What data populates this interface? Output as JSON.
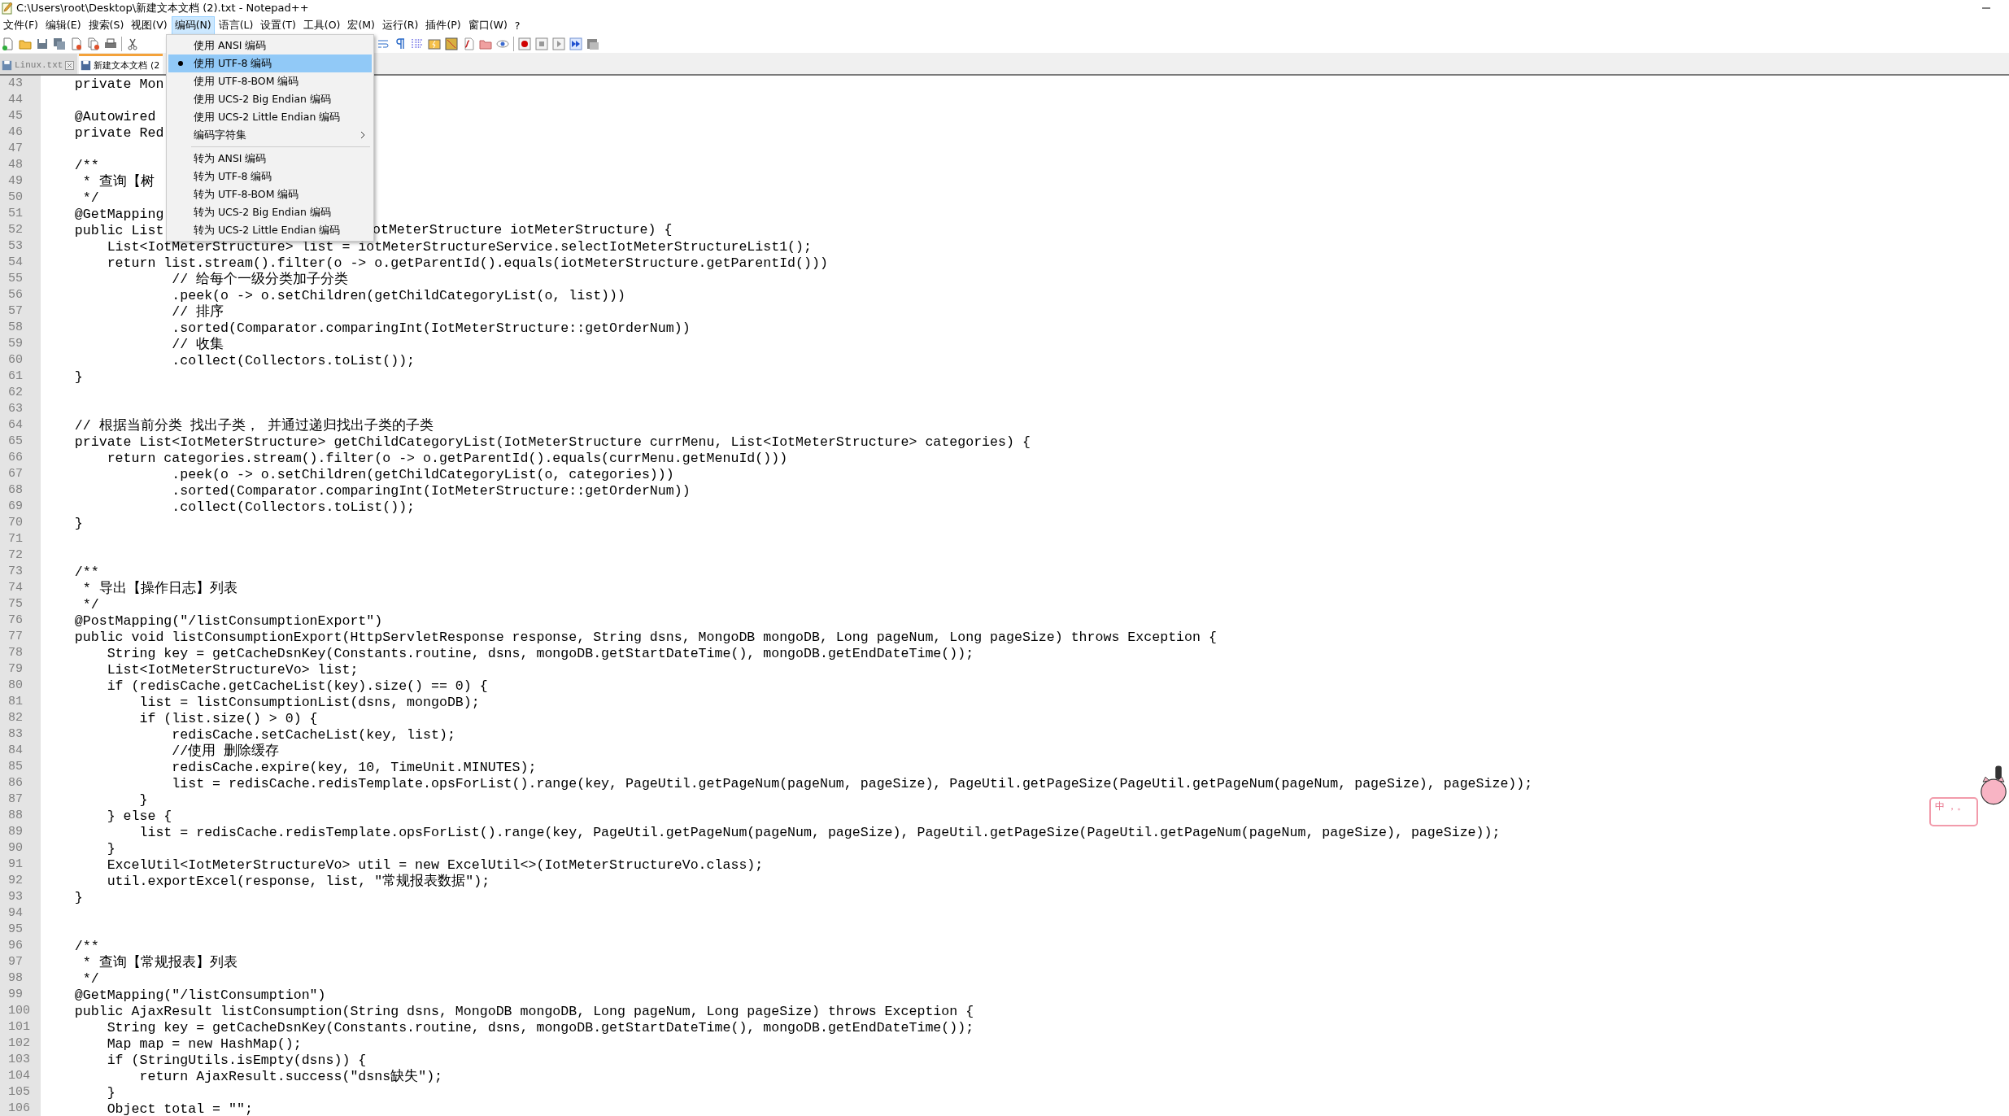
{
  "window": {
    "title": "C:\\Users\\root\\Desktop\\新建文本文档 (2).txt - Notepad++"
  },
  "menu_bar": [
    {
      "label": "文件(F)",
      "selected": false
    },
    {
      "label": "编辑(E)",
      "selected": false
    },
    {
      "label": "搜索(S)",
      "selected": false
    },
    {
      "label": "视图(V)",
      "selected": false
    },
    {
      "label": "编码(N)",
      "selected": true
    },
    {
      "label": "语言(L)",
      "selected": false
    },
    {
      "label": "设置(T)",
      "selected": false
    },
    {
      "label": "工具(O)",
      "selected": false
    },
    {
      "label": "宏(M)",
      "selected": false
    },
    {
      "label": "运行(R)",
      "selected": false
    },
    {
      "label": "插件(P)",
      "selected": false
    },
    {
      "label": "窗口(W)",
      "selected": false
    },
    {
      "label": "?",
      "selected": false
    }
  ],
  "tabs": [
    {
      "label": "Linux.txt",
      "selected": false
    },
    {
      "label": "新建文本文档 (2",
      "selected": true
    }
  ],
  "encoding_menu": [
    {
      "kind": "item",
      "label": "使用 ANSI 编码",
      "checked": false,
      "selected": false
    },
    {
      "kind": "item",
      "label": "使用 UTF-8 编码",
      "checked": true,
      "selected": true
    },
    {
      "kind": "item",
      "label": "使用 UTF-8-BOM 编码",
      "checked": false,
      "selected": false
    },
    {
      "kind": "item",
      "label": "使用 UCS-2 Big Endian 编码",
      "checked": false,
      "selected": false
    },
    {
      "kind": "item",
      "label": "使用 UCS-2 Little Endian 编码",
      "checked": false,
      "selected": false
    },
    {
      "kind": "submenu",
      "label": "编码字符集",
      "checked": false,
      "selected": false
    },
    {
      "kind": "separator"
    },
    {
      "kind": "item",
      "label": "转为 ANSI 编码",
      "checked": false,
      "selected": false
    },
    {
      "kind": "item",
      "label": "转为 UTF-8 编码",
      "checked": false,
      "selected": false
    },
    {
      "kind": "item",
      "label": "转为 UTF-8-BOM 编码",
      "checked": false,
      "selected": false
    },
    {
      "kind": "item",
      "label": "转为 UCS-2 Big Endian 编码",
      "checked": false,
      "selected": false
    },
    {
      "kind": "item",
      "label": "转为 UCS-2 Little Endian 编码",
      "checked": false,
      "selected": false
    }
  ],
  "editor_lines": [
    {
      "number": "43",
      "text": "    private Mon"
    },
    {
      "number": "44"
    },
    {
      "number": "45",
      "text": "    @Autowired"
    },
    {
      "number": "46",
      "text": "    private Red"
    },
    {
      "number": "47"
    },
    {
      "number": "48",
      "text": "    /**"
    },
    {
      "number": "49",
      "text": "     * 查询【树"
    },
    {
      "number": "50",
      "text": "     */"
    },
    {
      "number": "51",
      "text": "    @GetMapping"
    },
    {
      "number": "52",
      "text": "    public List",
      "tail": "otMeterStructure iotMeterStructure) {"
    },
    {
      "number": "53",
      "text": "        List<IotMeterStructure> list = iotMeterStructureService.selectIotMeterStructureList1();"
    },
    {
      "number": "54",
      "text": "        return list.stream().filter(o -> o.getParentId().equals(iotMeterStructure.getParentId()))"
    },
    {
      "number": "55",
      "text": "                // 给每个一级分类加子分类"
    },
    {
      "number": "56",
      "text": "                .peek(o -> o.setChildren(getChildCategoryList(o, list)))"
    },
    {
      "number": "57",
      "text": "                // 排序"
    },
    {
      "number": "58",
      "text": "                .sorted(Comparator.comparingInt(IotMeterStructure::getOrderNum))"
    },
    {
      "number": "59",
      "text": "                // 收集"
    },
    {
      "number": "60",
      "text": "                .collect(Collectors.toList());"
    },
    {
      "number": "61",
      "text": "    }"
    },
    {
      "number": "62"
    },
    {
      "number": "63"
    },
    {
      "number": "64",
      "text": "    // 根据当前分类 找出子类， 并通过递归找出子类的子类"
    },
    {
      "number": "65",
      "text": "    private List<IotMeterStructure> getChildCategoryList(IotMeterStructure currMenu, List<IotMeterStructure> categories) {"
    },
    {
      "number": "66",
      "text": "        return categories.stream().filter(o -> o.getParentId().equals(currMenu.getMenuId()))"
    },
    {
      "number": "67",
      "text": "                .peek(o -> o.setChildren(getChildCategoryList(o, categories)))"
    },
    {
      "number": "68",
      "text": "                .sorted(Comparator.comparingInt(IotMeterStructure::getOrderNum))"
    },
    {
      "number": "69",
      "text": "                .collect(Collectors.toList());"
    },
    {
      "number": "70",
      "text": "    }"
    },
    {
      "number": "71"
    },
    {
      "number": "72"
    },
    {
      "number": "73",
      "text": "    /**"
    },
    {
      "number": "74",
      "text": "     * 导出【操作日志】列表"
    },
    {
      "number": "75",
      "text": "     */"
    },
    {
      "number": "76",
      "text": "    @PostMapping(\"/listConsumptionExport\")"
    },
    {
      "number": "77",
      "text": "    public void listConsumptionExport(HttpServletResponse response, String dsns, MongoDB mongoDB, Long pageNum, Long pageSize) throws Exception {"
    },
    {
      "number": "78",
      "text": "        String key = getCacheDsnKey(Constants.routine, dsns, mongoDB.getStartDateTime(), mongoDB.getEndDateTime());"
    },
    {
      "number": "79",
      "text": "        List<IotMeterStructureVo> list;"
    },
    {
      "number": "80",
      "text": "        if (redisCache.getCacheList(key).size() == 0) {"
    },
    {
      "number": "81",
      "text": "            list = listConsumptionList(dsns, mongoDB);"
    },
    {
      "number": "82",
      "text": "            if (list.size() > 0) {"
    },
    {
      "number": "83",
      "text": "                redisCache.setCacheList(key, list);"
    },
    {
      "number": "84",
      "text": "                //使用 删除缓存"
    },
    {
      "number": "85",
      "text": "                redisCache.expire(key, 10, TimeUnit.MINUTES);"
    },
    {
      "number": "86",
      "text": "                list = redisCache.redisTemplate.opsForList().range(key, PageUtil.getPageNum(pageNum, pageSize), PageUtil.getPageSize(PageUtil.getPageNum(pageNum, pageSize), pageSize));"
    },
    {
      "number": "87",
      "text": "            }"
    },
    {
      "number": "88",
      "text": "        } else {"
    },
    {
      "number": "89",
      "text": "            list = redisCache.redisTemplate.opsForList().range(key, PageUtil.getPageNum(pageNum, pageSize), PageUtil.getPageSize(PageUtil.getPageNum(pageNum, pageSize), pageSize));"
    },
    {
      "number": "90",
      "text": "        }"
    },
    {
      "number": "91",
      "text": "        ExcelUtil<IotMeterStructureVo> util = new ExcelUtil<>(IotMeterStructureVo.class);"
    },
    {
      "number": "92",
      "text": "        util.exportExcel(response, list, \"常规报表数据\");"
    },
    {
      "number": "93",
      "text": "    }"
    },
    {
      "number": "94"
    },
    {
      "number": "95"
    },
    {
      "number": "96",
      "text": "    /**"
    },
    {
      "number": "97",
      "text": "     * 查询【常规报表】列表"
    },
    {
      "number": "98",
      "text": "     */"
    },
    {
      "number": "99",
      "text": "    @GetMapping(\"/listConsumption\")"
    },
    {
      "number": "100",
      "text": "    public AjaxResult listConsumption(String dsns, MongoDB mongoDB, Long pageNum, Long pageSize) throws Exception {"
    },
    {
      "number": "101",
      "text": "        String key = getCacheDsnKey(Constants.routine, dsns, mongoDB.getStartDateTime(), mongoDB.getEndDateTime());"
    },
    {
      "number": "102",
      "text": "        Map map = new HashMap();"
    },
    {
      "number": "103",
      "text": "        if (StringUtils.isEmpty(dsns)) {"
    },
    {
      "number": "104",
      "text": "            return AjaxResult.success(\"dsns缺失\");"
    },
    {
      "number": "105",
      "text": "        }"
    },
    {
      "number": "106",
      "text": "        Object total = \"\";"
    }
  ],
  "ime_widget": {
    "mode": "中",
    "punctuation": "，。"
  }
}
